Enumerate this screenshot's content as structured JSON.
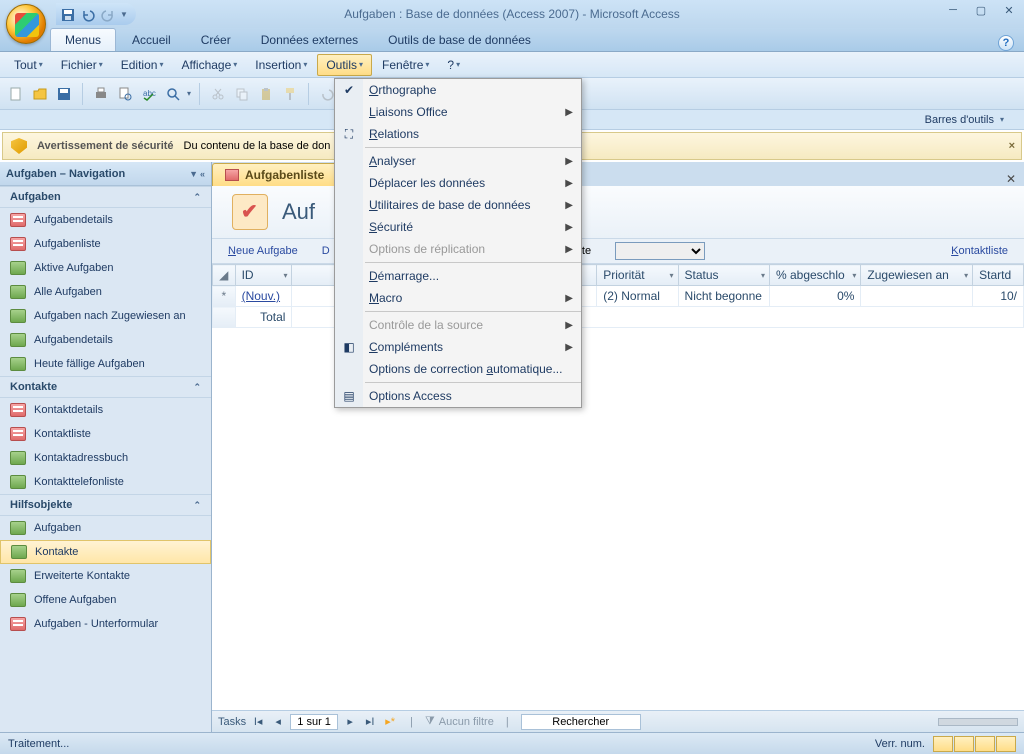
{
  "title": "Aufgaben : Base de données (Access 2007) - Microsoft Access",
  "ribbon": {
    "tabs": [
      "Menus",
      "Accueil",
      "Créer",
      "Données externes",
      "Outils de base de données"
    ],
    "active": 0
  },
  "menus": [
    "Tout",
    "Fichier",
    "Edition",
    "Affichage",
    "Insertion",
    "Outils",
    "Fenêtre",
    "?"
  ],
  "menu_active_index": 5,
  "toolbar_label": "Barres d'outils",
  "security": {
    "title": "Avertissement de sécurité",
    "msg": "Du contenu de la base de don"
  },
  "nav": {
    "header": "Aufgaben – Navigation",
    "groups": [
      {
        "name": "Aufgaben",
        "items": [
          {
            "label": "Aufgabendetails",
            "type": "form"
          },
          {
            "label": "Aufgabenliste",
            "type": "form"
          },
          {
            "label": "Aktive Aufgaben",
            "type": "table"
          },
          {
            "label": "Alle Aufgaben",
            "type": "table"
          },
          {
            "label": "Aufgaben nach Zugewiesen an",
            "type": "table"
          },
          {
            "label": "Aufgabendetails",
            "type": "table"
          },
          {
            "label": "Heute fällige Aufgaben",
            "type": "table"
          }
        ]
      },
      {
        "name": "Kontakte",
        "items": [
          {
            "label": "Kontaktdetails",
            "type": "form"
          },
          {
            "label": "Kontaktliste",
            "type": "form"
          },
          {
            "label": "Kontaktadressbuch",
            "type": "table"
          },
          {
            "label": "Kontakttelefonliste",
            "type": "table"
          }
        ]
      },
      {
        "name": "Hilfsobjekte",
        "items": [
          {
            "label": "Aufgaben",
            "type": "table"
          },
          {
            "label": "Kontakte",
            "type": "table",
            "selected": true
          },
          {
            "label": "Erweiterte Kontakte",
            "type": "table"
          },
          {
            "label": "Offene Aufgaben",
            "type": "table"
          },
          {
            "label": "Aufgaben - Unterformular",
            "type": "form"
          }
        ]
      }
    ]
  },
  "doc": {
    "tab_title": "Aufgabenliste",
    "form_title": "Auf",
    "toolbar": {
      "new": "Neue Aufgabe",
      "d": "D",
      "hte_label": "hte",
      "contacts": "Kontaktliste"
    },
    "columns": [
      "ID",
      "",
      "Priorität",
      "Status",
      "% abgeschlo",
      "Zugewiesen an",
      "Startd"
    ],
    "row": {
      "id": "(Nouv.)",
      "priority": "(2) Normal",
      "status": "Nicht begonne",
      "pct": "0%",
      "startd": "10/"
    },
    "total_label": "Total"
  },
  "dropdown": {
    "items": [
      {
        "label": "Orthographe",
        "icon": "abc",
        "u": 0
      },
      {
        "label": "Liaisons Office",
        "sub": true,
        "u": 0
      },
      {
        "label": "Relations",
        "icon": "rel",
        "u": 0,
        "sep_after": true
      },
      {
        "label": "Analyser",
        "sub": true,
        "u": 0
      },
      {
        "label": "Déplacer les données",
        "sub": true
      },
      {
        "label": "Utilitaires de base de données",
        "sub": true,
        "u": 0
      },
      {
        "label": "Sécurité",
        "sub": true,
        "u": 0
      },
      {
        "label": "Options de réplication",
        "sub": true,
        "disabled": true,
        "sep_after": true
      },
      {
        "label": "Démarrage...",
        "u": 0
      },
      {
        "label": "Macro",
        "sub": true,
        "u": 0,
        "sep_after": true
      },
      {
        "label": "Contrôle de la source",
        "sub": true,
        "disabled": true
      },
      {
        "label": "Compléments",
        "sub": true,
        "icon": "comp",
        "u": 0
      },
      {
        "label": "Options de correction automatique...",
        "u": 22,
        "sep_after": true
      },
      {
        "label": "Options Access",
        "icon": "opt"
      }
    ]
  },
  "recnav": {
    "label": "Tasks",
    "pos": "1 sur 1",
    "filter": "Aucun filtre",
    "search": "Rechercher"
  },
  "status": {
    "left": "Traitement...",
    "lock": "Verr. num."
  }
}
